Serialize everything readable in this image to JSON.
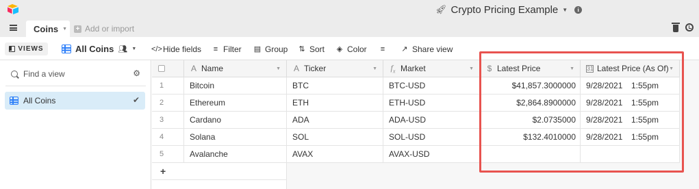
{
  "app": {
    "title": "Crypto Pricing Example",
    "title_icon": "rocket-icon",
    "logo_colors": [
      "#fcb400",
      "#18bfff",
      "#f82b60"
    ]
  },
  "tabs": {
    "active_label": "Coins",
    "add_import_label": "Add or import"
  },
  "toolbar": {
    "views_label": "VIEWS",
    "view_name": "All Coins",
    "hide_fields": "Hide fields",
    "filter": "Filter",
    "group": "Group",
    "sort": "Sort",
    "color": "Color",
    "row_height_icon": "row-height-icon",
    "share_view": "Share view"
  },
  "sidebar": {
    "find_placeholder": "Find a view",
    "views": [
      {
        "label": "All Coins",
        "selected": true
      }
    ]
  },
  "table": {
    "columns": [
      {
        "label": "Name",
        "icon": "text-field-icon"
      },
      {
        "label": "Ticker",
        "icon": "text-field-icon"
      },
      {
        "label": "Market",
        "icon": "formula-icon"
      },
      {
        "label": "Latest Price",
        "icon": "currency-icon"
      },
      {
        "label": "Latest Price (As Of)",
        "icon": "date-icon"
      }
    ],
    "rows": [
      {
        "num": "1",
        "name": "Bitcoin",
        "ticker": "BTC",
        "market": "BTC-USD",
        "price": "$41,857.3000000",
        "date": "9/28/2021",
        "time": "1:55pm"
      },
      {
        "num": "2",
        "name": "Ethereum",
        "ticker": "ETH",
        "market": "ETH-USD",
        "price": "$2,864.8900000",
        "date": "9/28/2021",
        "time": "1:55pm"
      },
      {
        "num": "3",
        "name": "Cardano",
        "ticker": "ADA",
        "market": "ADA-USD",
        "price": "$2.0735000",
        "date": "9/28/2021",
        "time": "1:55pm"
      },
      {
        "num": "4",
        "name": "Solana",
        "ticker": "SOL",
        "market": "SOL-USD",
        "price": "$132.4010000",
        "date": "9/28/2021",
        "time": "1:55pm"
      },
      {
        "num": "5",
        "name": "Avalanche",
        "ticker": "AVAX",
        "market": "AVAX-USD",
        "price": "",
        "date": "",
        "time": ""
      }
    ],
    "add_row_label": "+"
  },
  "annotation": {
    "highlight_color": "#e8534f"
  }
}
